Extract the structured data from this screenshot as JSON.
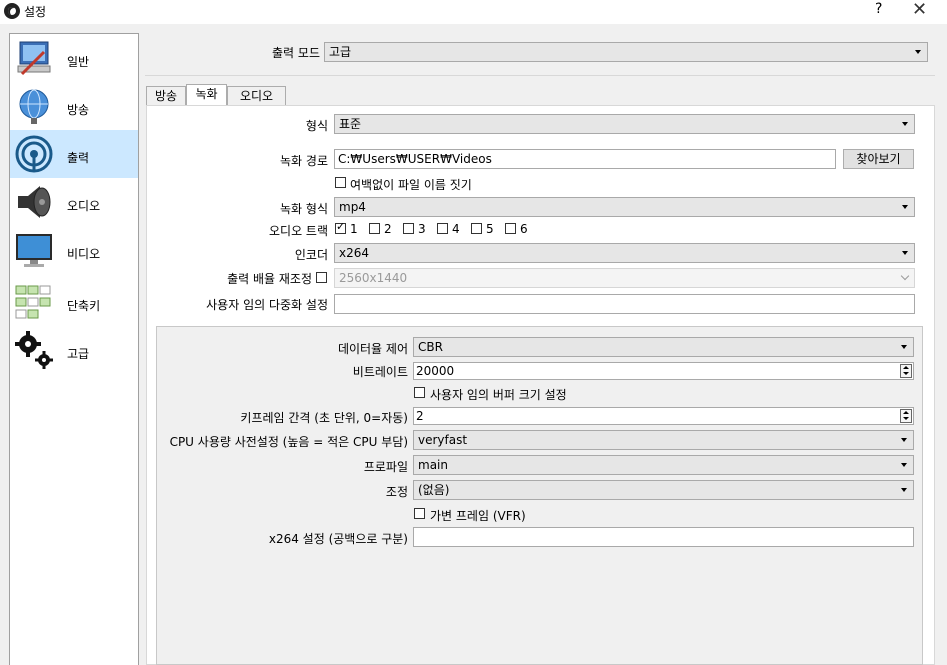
{
  "window": {
    "title": "설정",
    "help": "?",
    "close": "✕"
  },
  "sidebar": {
    "items": [
      {
        "label": "일반",
        "icon": "general-computer-icon"
      },
      {
        "label": "방송",
        "icon": "broadcast-globe-icon"
      },
      {
        "label": "출력",
        "icon": "output-signal-icon",
        "selected": true
      },
      {
        "label": "오디오",
        "icon": "speaker-icon"
      },
      {
        "label": "비디오",
        "icon": "monitor-icon"
      },
      {
        "label": "단축키",
        "icon": "hotkeys-grid-icon"
      },
      {
        "label": "고급",
        "icon": "gears-icon"
      }
    ]
  },
  "output_mode": {
    "label": "출력 모드",
    "value": "고급"
  },
  "tabs": [
    {
      "label": "방송"
    },
    {
      "label": "녹화",
      "active": true
    },
    {
      "label": "오디오"
    }
  ],
  "recording": {
    "type": {
      "label": "형식",
      "value": "표준"
    },
    "path": {
      "label": "녹화 경로",
      "value": "C:₩Users₩USER₩Videos",
      "browse": "찾아보기"
    },
    "no_space_filename": {
      "label": "여백없이 파일 이름 짓기",
      "checked": false
    },
    "format": {
      "label": "녹화 형식",
      "value": "mp4"
    },
    "audio_track": {
      "label": "오디오 트랙",
      "tracks": [
        "1",
        "2",
        "3",
        "4",
        "5",
        "6"
      ],
      "checked": [
        true,
        false,
        false,
        false,
        false,
        false
      ]
    },
    "encoder": {
      "label": "인코더",
      "value": "x264"
    },
    "rescale": {
      "label": "출력 배율 재조정",
      "checked": false,
      "value": "2560x1440"
    },
    "muxer": {
      "label": "사용자 임의 다중화 설정",
      "value": ""
    }
  },
  "encoder_settings": {
    "rate_control": {
      "label": "데이터율 제어",
      "value": "CBR"
    },
    "bitrate": {
      "label": "비트레이트",
      "value": "20000"
    },
    "custom_buffer": {
      "label": "사용자 임의 버퍼 크기 설정",
      "checked": false
    },
    "keyframe": {
      "label": "키프레임 간격 (초 단위, 0=자동)",
      "value": "2"
    },
    "cpu_preset": {
      "label": "CPU 사용량 사전설정 (높음 = 적은 CPU 부담)",
      "value": "veryfast"
    },
    "profile": {
      "label": "프로파일",
      "value": "main"
    },
    "tune": {
      "label": "조정",
      "value": "(없음)"
    },
    "vfr": {
      "label": "가변 프레임 (VFR)",
      "checked": false
    },
    "x264_opts": {
      "label": "x264 설정 (공백으로 구분)",
      "value": ""
    }
  }
}
